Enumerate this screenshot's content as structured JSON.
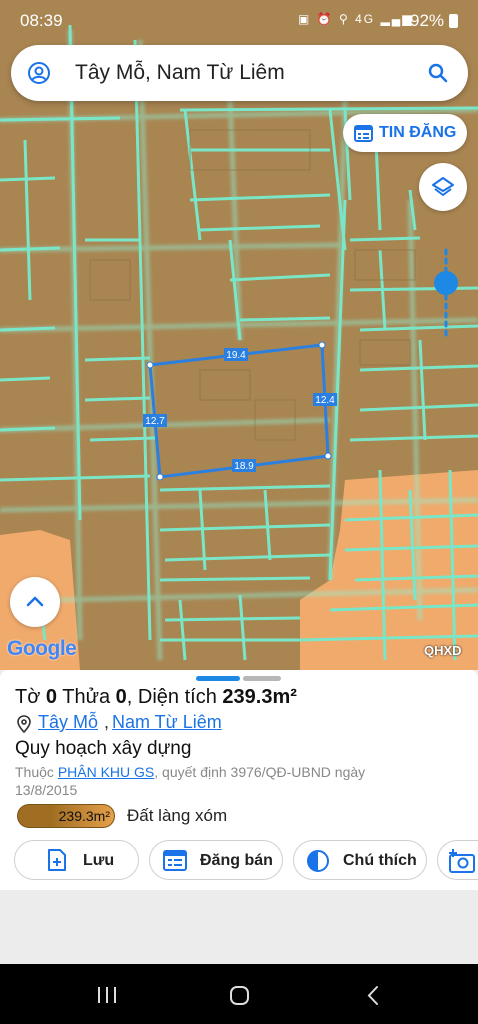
{
  "status_bar": {
    "time": "08:39",
    "signal_text": "4G",
    "battery": "92%"
  },
  "search": {
    "title": "Tây Mỗ, Nam Từ Liêm"
  },
  "map": {
    "tin_dang_label": "TIN ĐĂNG",
    "google_label": "Google",
    "layer_code": "QHXD",
    "dimensions": {
      "top": "19.4",
      "right": "12.4",
      "bottom": "18.9",
      "left": "12.7"
    }
  },
  "sheet": {
    "parcel": {
      "to_label": "Tờ",
      "to_value": "0",
      "thua_label": "Thửa",
      "thua_value": "0",
      "area_label": "Diện tích",
      "area_value": "239.3m²"
    },
    "location": {
      "ward": "Tây Mỗ",
      "district": "Nam Từ Liêm"
    },
    "section_title": "Quy hoạch xây dựng",
    "decision": {
      "prefix": "Thuộc",
      "zone": "PHÂN KHU GS",
      "text": ", quyết định 3976/QĐ-UBND ngày 13/8/2015"
    },
    "land_area_badge": "239.3m²",
    "land_type": "Đất làng xóm",
    "actions": [
      {
        "label": "Lưu",
        "icon": "add-note-icon"
      },
      {
        "label": "Đăng bán",
        "icon": "calendar-icon"
      },
      {
        "label": "Chú thích",
        "icon": "legend-icon"
      },
      {
        "label": "",
        "icon": "add-photo-icon"
      }
    ]
  },
  "colors": {
    "accent": "#1a73e8",
    "land_brown": "#a98552",
    "land_orange": "#f0aa6c",
    "parcel_grid": "#7ae6c8"
  }
}
